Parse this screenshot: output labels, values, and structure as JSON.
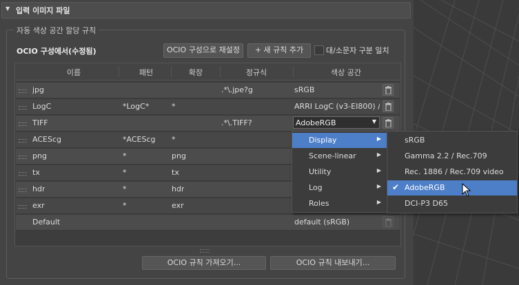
{
  "rollout": {
    "title": "입력 이미지 파일"
  },
  "group": {
    "title": "자동 색상 공간 할당 규칙"
  },
  "ocio": {
    "label": "OCIO 구성에서(수정됨)",
    "reset_button": "OCIO 구성으로 재설정",
    "add_rule_button": "+ 새 규칙 추가",
    "case_checkbox_label": "대/소문자 구분 일치",
    "case_checked": false
  },
  "table": {
    "headers": [
      "이름",
      "패턴",
      "확장",
      "정규식",
      "색상 공간"
    ],
    "rows": [
      {
        "name": "jpg",
        "pattern": "",
        "ext": "",
        "regex": ".*\\.jpe?g",
        "colorspace": "sRGB"
      },
      {
        "name": "LogC",
        "pattern": "*LogC*",
        "ext": "*",
        "regex": "",
        "colorspace": "ARRI LogC (v3-EI800) / A"
      },
      {
        "name": "TIFF",
        "pattern": "",
        "ext": "",
        "regex": ".*\\.TIFF?",
        "colorspace": "AdobeRGB"
      },
      {
        "name": "ACEScg",
        "pattern": "*ACEScg",
        "ext": "*",
        "regex": "",
        "colorspace": ""
      },
      {
        "name": "png",
        "pattern": "*",
        "ext": "png",
        "regex": "",
        "colorspace": ""
      },
      {
        "name": "tx",
        "pattern": "*",
        "ext": "tx",
        "regex": "",
        "colorspace": ""
      },
      {
        "name": "hdr",
        "pattern": "*",
        "ext": "hdr",
        "regex": "",
        "colorspace": ""
      },
      {
        "name": "exr",
        "pattern": "*",
        "ext": "exr",
        "regex": "",
        "colorspace": ""
      },
      {
        "name": "Default",
        "pattern": "",
        "ext": "",
        "regex": "",
        "colorspace": "default (sRGB)"
      }
    ]
  },
  "buttons": {
    "import": "OCIO 규칙 가져오기...",
    "export": "OCIO 규칙 내보내기..."
  },
  "menu_categories": [
    {
      "label": "Display",
      "highlighted": true
    },
    {
      "label": "Scene-linear",
      "highlighted": false
    },
    {
      "label": "Utility",
      "highlighted": false
    },
    {
      "label": "Log",
      "highlighted": false
    },
    {
      "label": "Roles",
      "highlighted": false
    }
  ],
  "menu_display": [
    {
      "label": "sRGB",
      "checked": false
    },
    {
      "label": "Gamma 2.2 / Rec.709",
      "checked": false
    },
    {
      "label": "Rec. 1886 / Rec.709 video",
      "checked": false
    },
    {
      "label": "AdobeRGB",
      "checked": true
    },
    {
      "label": "DCI-P3 D65",
      "checked": false
    }
  ],
  "icons": {
    "collapse": "triangle-down-icon",
    "trash": "trash-icon",
    "submenu": "chevron-right-icon",
    "check": "checkmark-icon",
    "cursor": "mouse-pointer-icon"
  },
  "colors": {
    "highlight": "#4d7fc8",
    "panel": "#444444"
  }
}
